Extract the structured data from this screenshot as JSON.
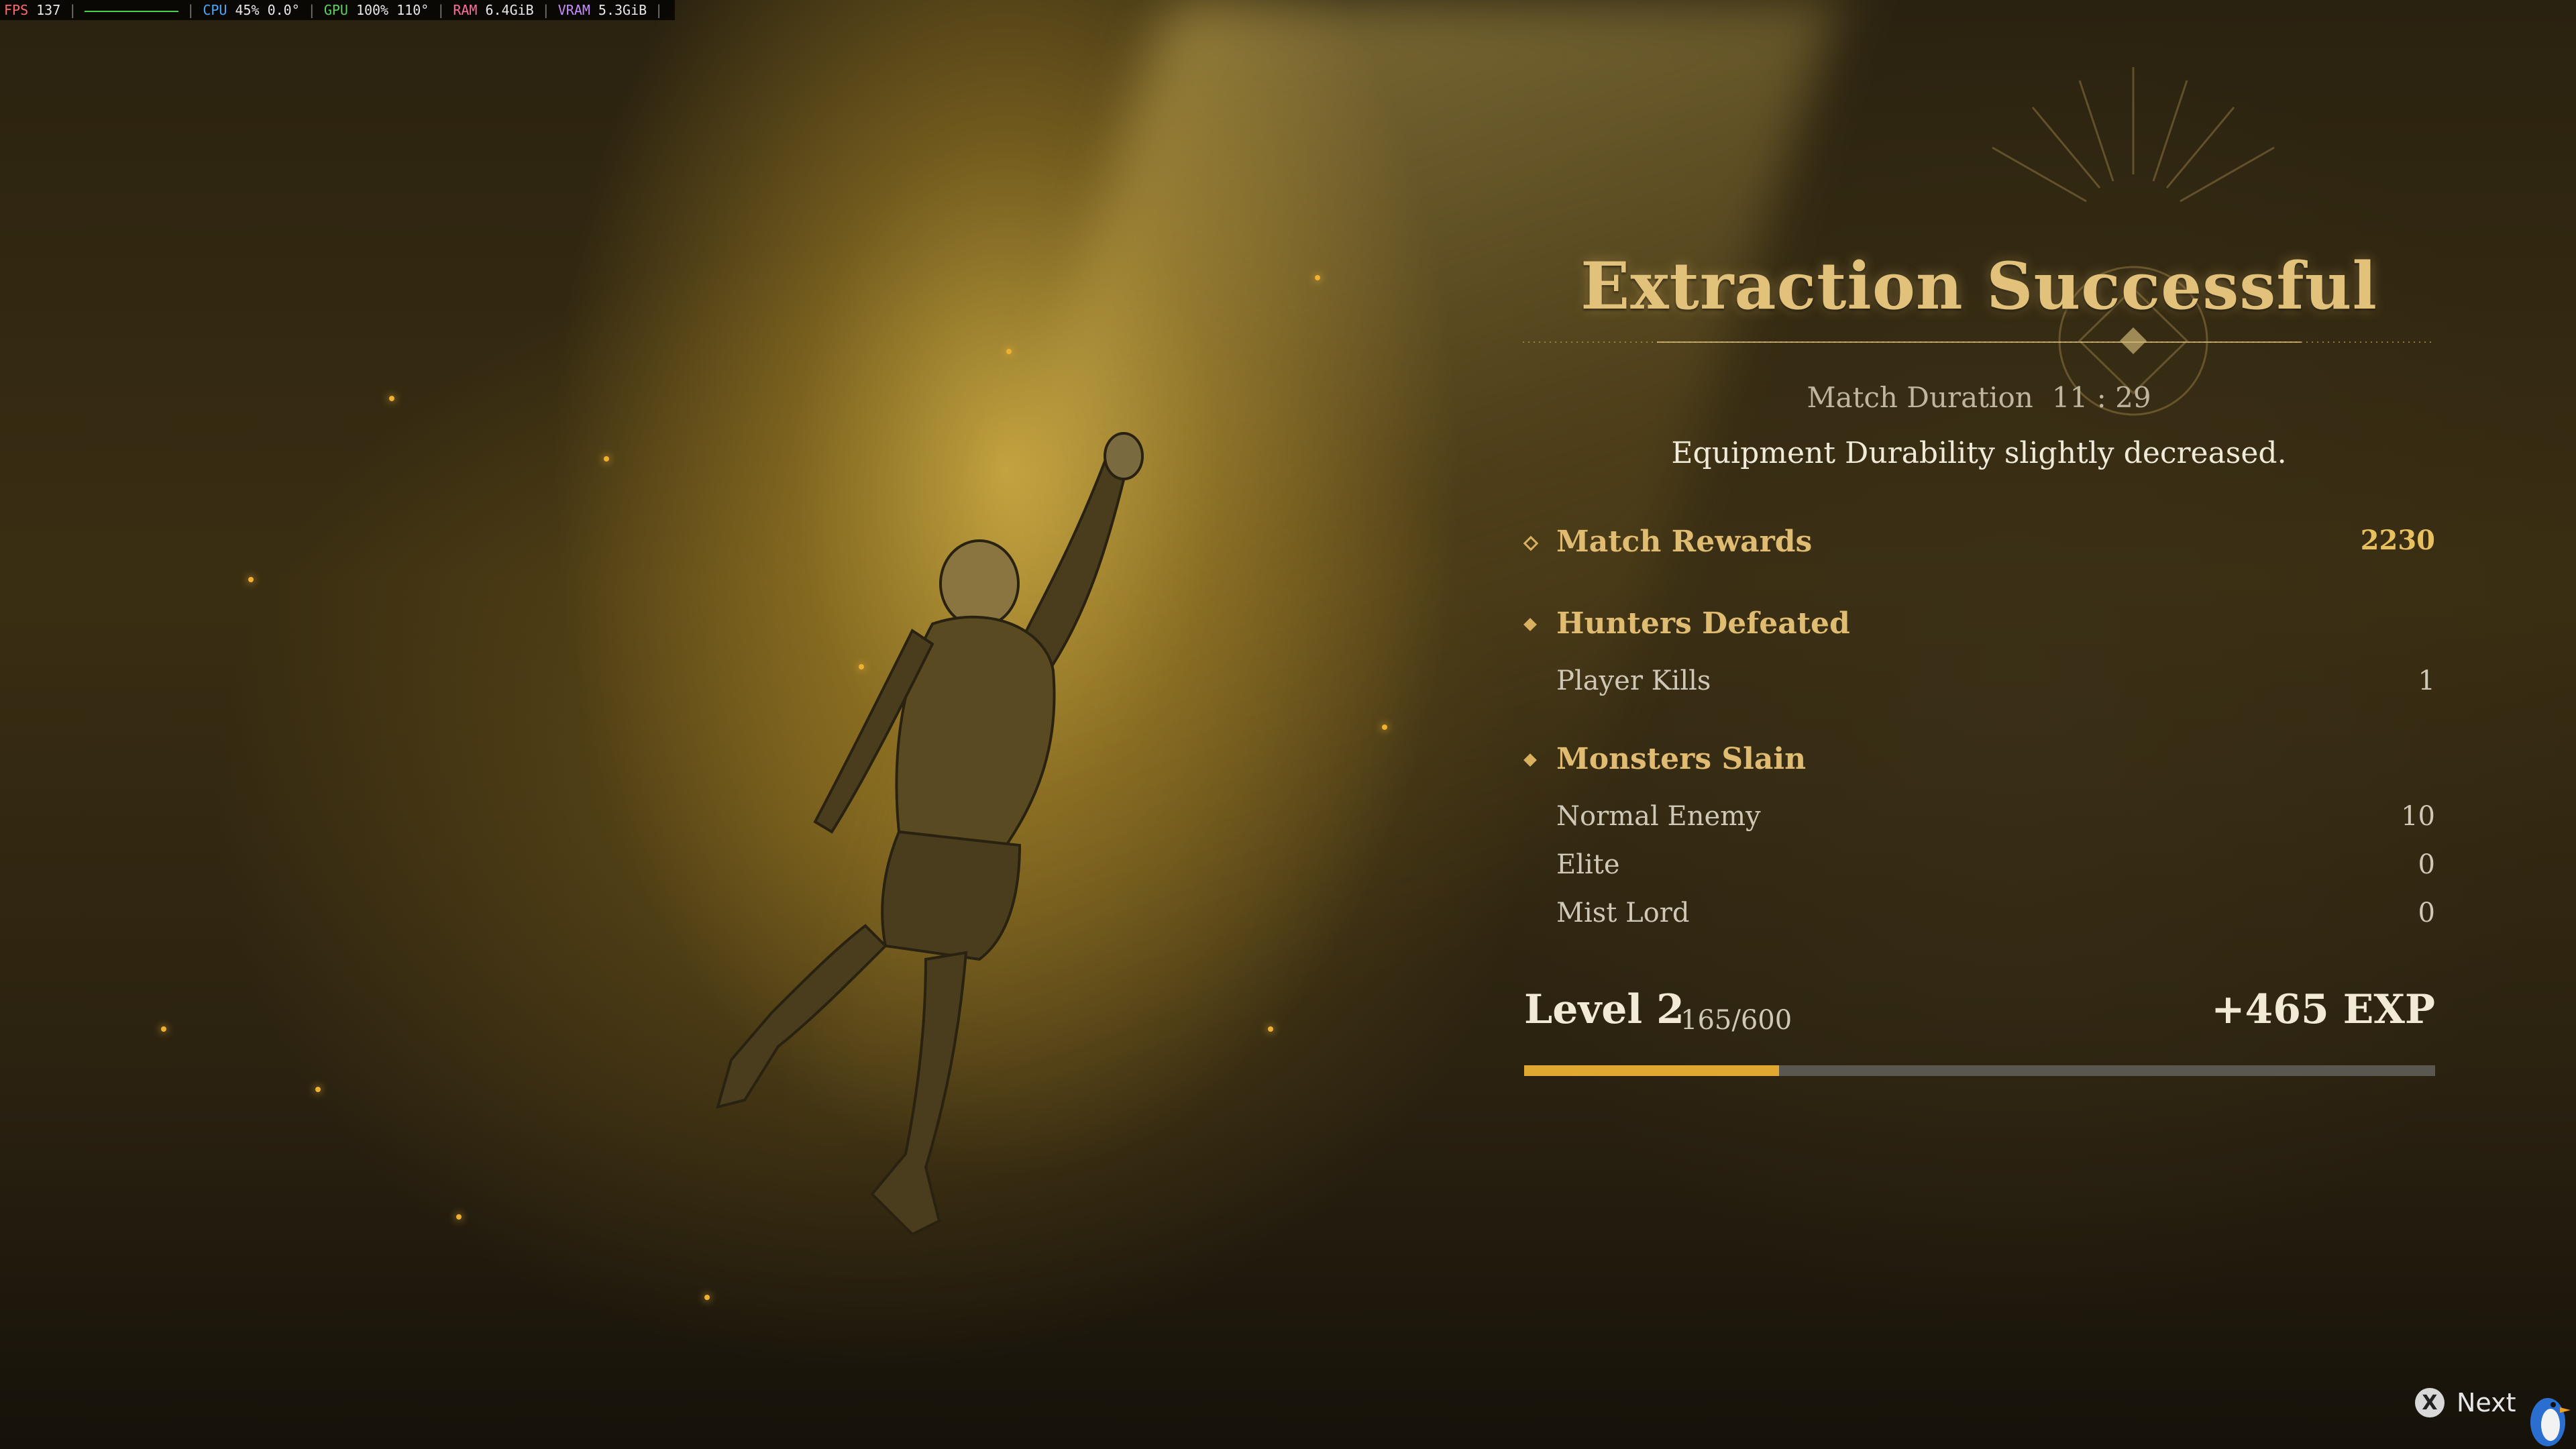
{
  "hud": {
    "fps_label": "FPS",
    "fps": "137",
    "cpu_label": "CPU",
    "cpu_usage": "45%",
    "cpu_temp": "0.0°",
    "gpu_label": "GPU",
    "gpu_usage": "100%",
    "gpu_temp": "110°",
    "ram_label": "RAM",
    "ram": "6.4GiB",
    "vram_label": "VRAM",
    "vram": "5.3GiB"
  },
  "results": {
    "title": "Extraction Successful",
    "duration_label": "Match Duration",
    "duration_value": "11 : 29",
    "durability_note": "Equipment Durability slightly decreased."
  },
  "sections": {
    "rewards": {
      "label": "Match Rewards",
      "value": "2230"
    },
    "hunters": {
      "label": "Hunters Defeated",
      "rows": [
        {
          "label": "Player Kills",
          "value": "1"
        }
      ]
    },
    "monsters": {
      "label": "Monsters Slain",
      "rows": [
        {
          "label": "Normal Enemy",
          "value": "10"
        },
        {
          "label": "Elite",
          "value": "0"
        },
        {
          "label": "Mist Lord",
          "value": "0"
        }
      ]
    }
  },
  "level": {
    "label": "Level 2",
    "progress_text": "165/600",
    "progress_fraction": 0.28,
    "exp_gain": "+465 EXP"
  },
  "footer": {
    "button_glyph": "X",
    "next_label": "Next"
  },
  "colors": {
    "accent_gold": "#e0bc72",
    "bar_fill": "#e0a830",
    "bar_track": "#5a5650"
  }
}
